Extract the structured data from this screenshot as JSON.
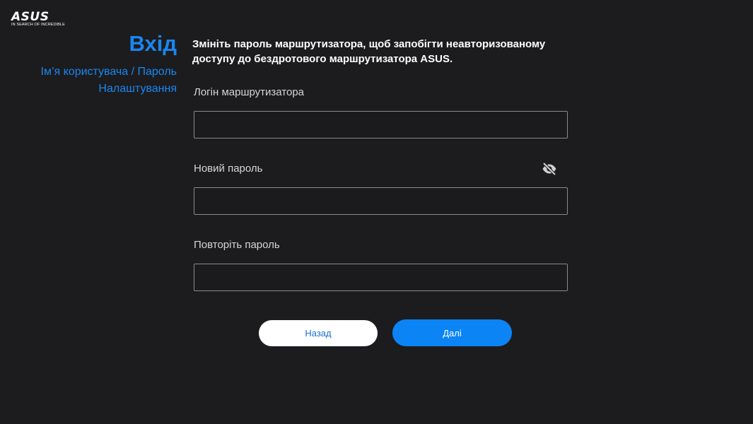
{
  "brand": {
    "logo_text": "ASUS",
    "tagline": "IN SEARCH OF INCREDIBLE"
  },
  "sidebar": {
    "title": "Вхід",
    "steps": [
      {
        "label": "Ім’я користувача / Пароль"
      },
      {
        "label": "Налаштування"
      }
    ]
  },
  "main": {
    "intro": "Змініть пароль маршрутизатора, щоб запобігти неавторизованому доступу до бездротового маршрутизатора ASUS.",
    "fields": {
      "login": {
        "label": "Логін маршрутизатора",
        "value": ""
      },
      "new_password": {
        "label": "Новий пароль",
        "value": ""
      },
      "repeat_password": {
        "label": "Повторіть пароль",
        "value": ""
      }
    },
    "toggle_visibility_icon": "eye-off-icon"
  },
  "buttons": {
    "back_label": "Назад",
    "next_label": "Далі"
  },
  "colors": {
    "background": "#1c1c1e",
    "accent": "#1a86f0",
    "primary_button": "#0b84f5",
    "input_border": "#8a8a8c"
  }
}
